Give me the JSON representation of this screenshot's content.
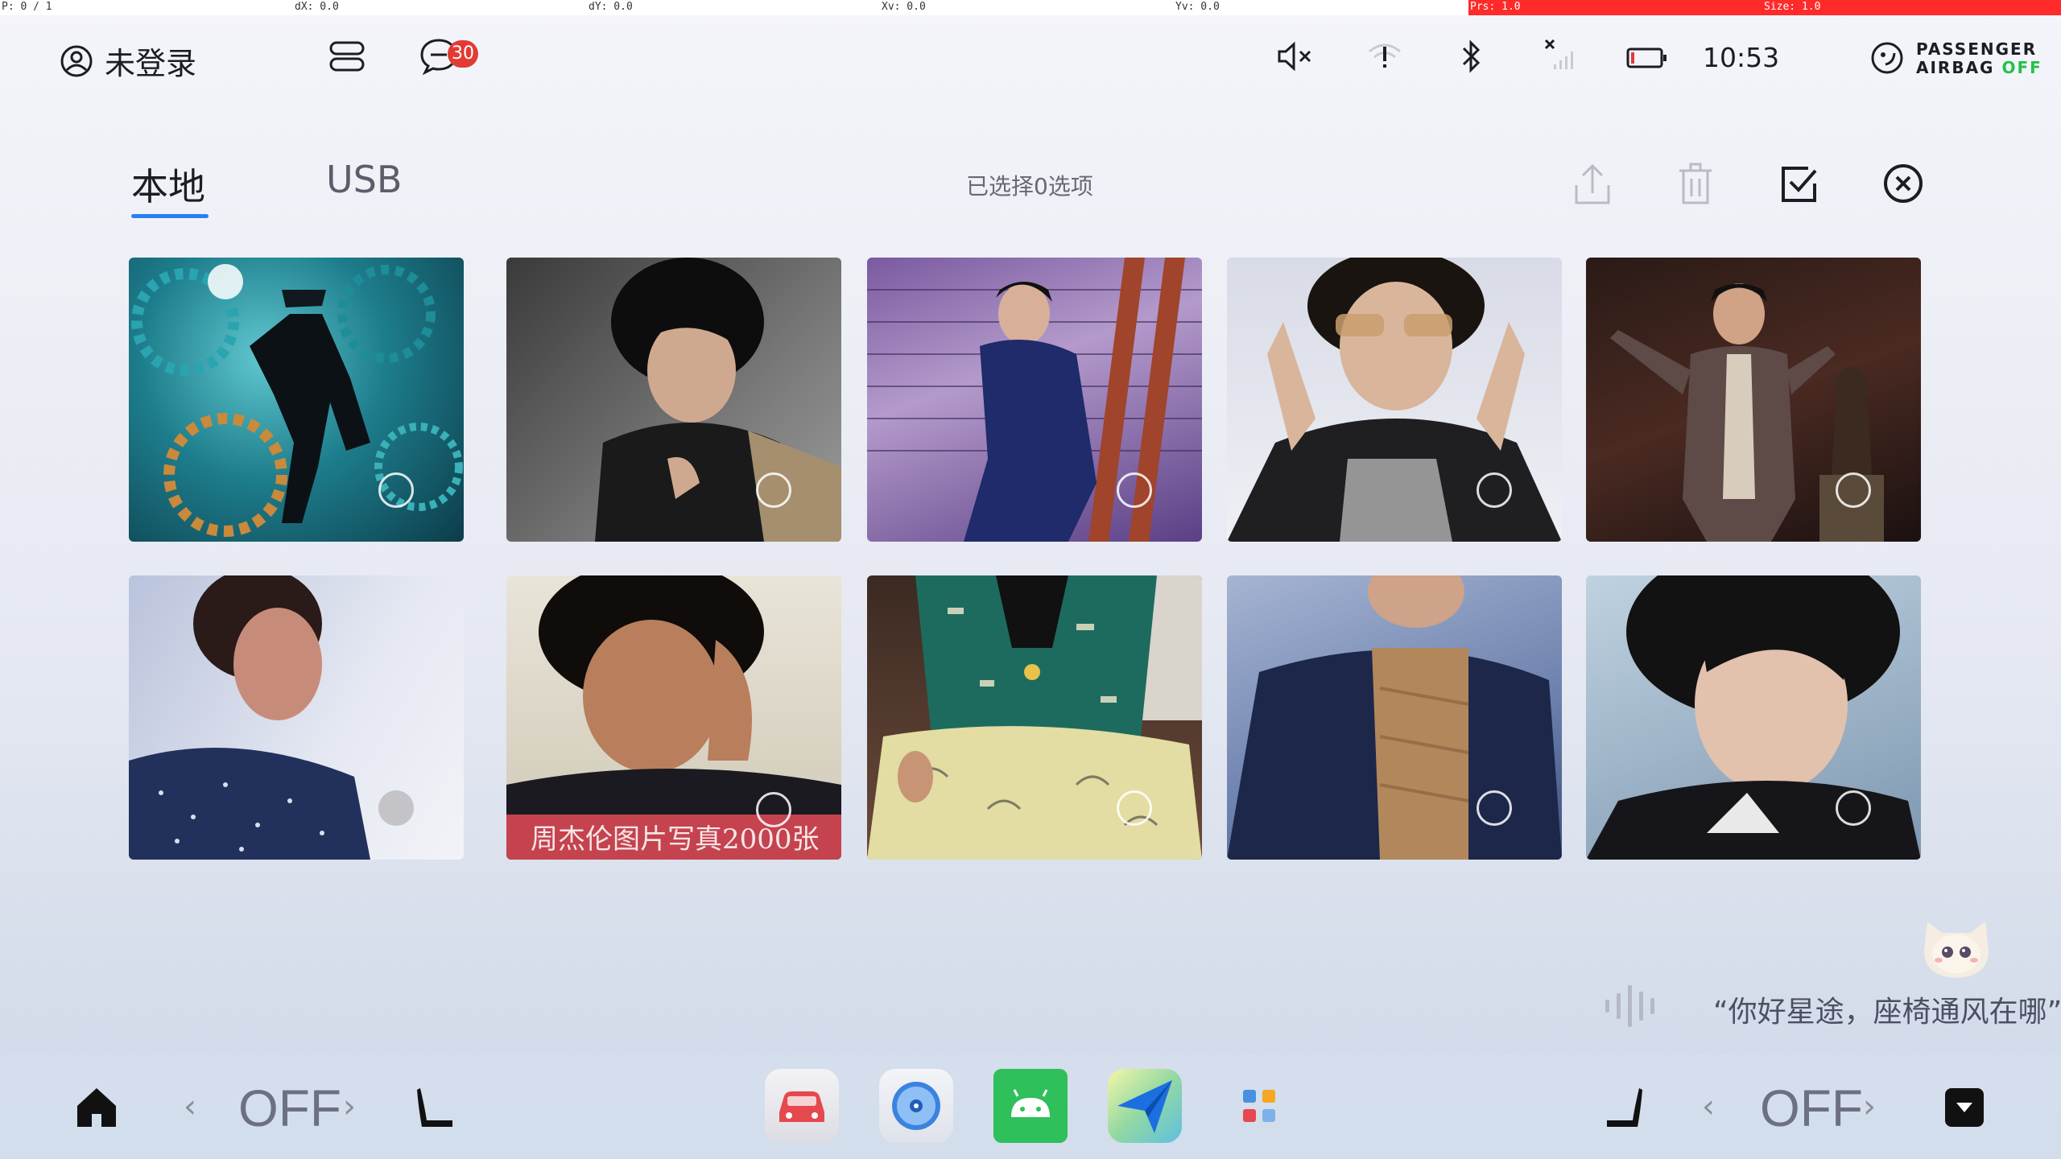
{
  "debug": {
    "p": "P: 0 / 1",
    "dx": "dX: 0.0",
    "dy": "dY: 0.0",
    "xv": "Xv: 0.0",
    "yv": "Yv: 0.0",
    "prs": "Prs: 1.0",
    "size": "Size: 1.0"
  },
  "status": {
    "user_label": "未登录",
    "notification_count": "30",
    "time": "10:53",
    "airbag_line1": "PASSENGER",
    "airbag_line2": "AIRBAG",
    "airbag_state": "OFF"
  },
  "gallery": {
    "tabs": [
      {
        "label": "本地",
        "active": true
      },
      {
        "label": "USB",
        "active": false
      }
    ],
    "selection_text": "已选择0选项",
    "actions": [
      "upload-icon",
      "trash-icon",
      "check-square-icon",
      "close-circle-icon"
    ],
    "photos": [
      {
        "id": 1,
        "caption": ""
      },
      {
        "id": 2,
        "caption": ""
      },
      {
        "id": 3,
        "caption": ""
      },
      {
        "id": 4,
        "caption": ""
      },
      {
        "id": 5,
        "caption": ""
      },
      {
        "id": 6,
        "caption": ""
      },
      {
        "id": 7,
        "caption": "周杰伦图片写真2000张"
      },
      {
        "id": 8,
        "caption": ""
      },
      {
        "id": 9,
        "caption": ""
      },
      {
        "id": 10,
        "caption": ""
      }
    ]
  },
  "assistant": {
    "hint": "“你好星途，座椅通风在哪”"
  },
  "dock": {
    "left_seat_state": "OFF",
    "right_seat_state": "OFF",
    "apps": [
      "car-app-icon",
      "music-disc-app-icon",
      "android-app-icon",
      "navigation-app-icon",
      "app-grid-icon"
    ]
  },
  "colors": {
    "accent": "#2a7ff0",
    "badge": "#e23b35",
    "airbag_off": "#24c24a",
    "caption_bar": "#c4434f"
  }
}
